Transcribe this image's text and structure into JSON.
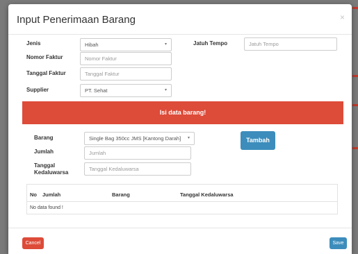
{
  "modal": {
    "title": "Input Penerimaan Barang",
    "close": "×"
  },
  "form": {
    "jenis": {
      "label": "Jenis",
      "value": "Hibah"
    },
    "jatuh_tempo": {
      "label": "Jatuh Tempo",
      "placeholder": "Jatuh Tempo"
    },
    "nomor_faktur": {
      "label": "Nomor Faktur",
      "placeholder": "Nomor Faktur"
    },
    "tanggal_faktur": {
      "label": "Tanggal Faktur",
      "placeholder": "Tanggal Faktur"
    },
    "supplier": {
      "label": "Supplier",
      "value": "PT. Sehat"
    }
  },
  "alert": {
    "text": "Isi data barang!"
  },
  "item_form": {
    "barang": {
      "label": "Barang",
      "value": "Single Bag 350cc JMS [Kantong Darah]"
    },
    "jumlah": {
      "label": "Jumlah",
      "placeholder": "Jumlah"
    },
    "tanggal_kedaluwarsa": {
      "label_line1": "Tanggal",
      "label_line2": "Kedaluwarsa",
      "placeholder": "Tanggal Kedaluwarsa"
    },
    "tambah_label": "Tambah"
  },
  "table": {
    "headers": [
      "No",
      "Jumlah",
      "Barang",
      "Tanggal Kedaluwarsa"
    ],
    "empty_text": "No data found !"
  },
  "footer": {
    "cancel_label": "Cancel",
    "save_label": "Save"
  },
  "icons": {
    "dropdown": "▾"
  },
  "colors": {
    "danger": "#dd4b39",
    "primary": "#3c8dbc"
  }
}
